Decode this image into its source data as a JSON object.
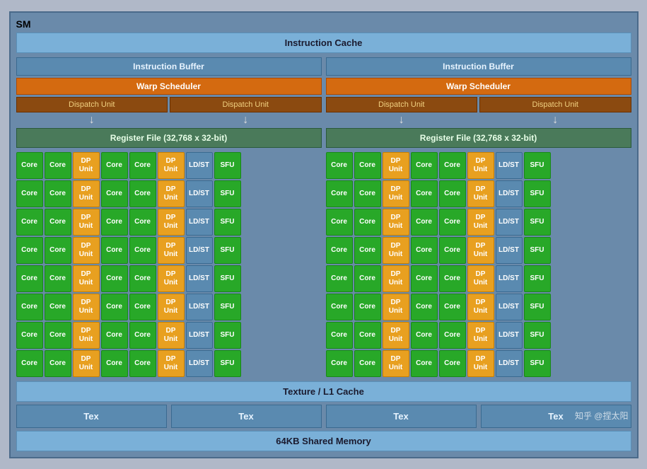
{
  "sm": {
    "label": "SM",
    "instruction_cache": "Instruction Cache",
    "halves": [
      {
        "instruction_buffer": "Instruction Buffer",
        "warp_scheduler": "Warp Scheduler",
        "dispatch_units": [
          "Dispatch Unit",
          "Dispatch Unit"
        ],
        "register_file": "Register File (32,768 x 32-bit)"
      },
      {
        "instruction_buffer": "Instruction Buffer",
        "warp_scheduler": "Warp Scheduler",
        "dispatch_units": [
          "Dispatch Unit",
          "Dispatch Unit"
        ],
        "register_file": "Register File (32,768 x 32-bit)"
      }
    ],
    "core_rows": 8,
    "row_pattern": [
      "Core",
      "Core",
      "DP Unit",
      "Core",
      "Core",
      "DP Unit",
      "LD/ST",
      "SFU"
    ],
    "texture_cache": "Texture / L1 Cache",
    "tex_units": [
      "Tex",
      "Tex",
      "Tex",
      "Tex"
    ],
    "shared_memory": "64KB Shared Memory",
    "watermark": "知乎 @捏太阳"
  }
}
